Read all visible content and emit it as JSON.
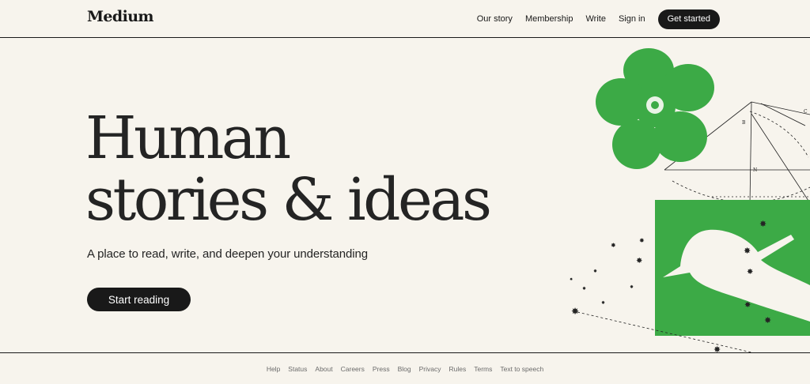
{
  "header": {
    "logo": "Medium",
    "nav": [
      "Our story",
      "Membership",
      "Write",
      "Sign in"
    ],
    "cta": "Get started"
  },
  "hero": {
    "title_line1": "Human",
    "title_line2": "stories & ideas",
    "subtitle": "A place to read, write, and deepen your understanding",
    "button": "Start reading"
  },
  "illustration": {
    "icon": "flower-and-hand-illustration",
    "accent_color": "#3caa46"
  },
  "footer": {
    "links": [
      "Help",
      "Status",
      "About",
      "Careers",
      "Press",
      "Blog",
      "Privacy",
      "Rules",
      "Terms",
      "Text to speech"
    ]
  }
}
